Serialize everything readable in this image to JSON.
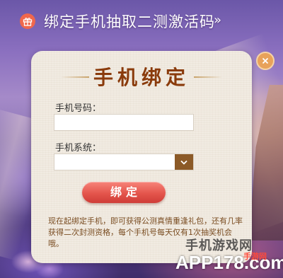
{
  "banner": {
    "title": "绑定手机抽取二测激活码",
    "chevron": "»",
    "icon": "gift-icon"
  },
  "dialog": {
    "title": "手机绑定",
    "phone_label": "手机号码：",
    "phone_value": "",
    "system_label": "手机系统：",
    "system_value": "",
    "bind_button": "绑定",
    "notice": "现在起绑定手机，即可获得公测真情重逢礼包，还有几率获得二次封测资格，每个手机号每天仅有1次抽奖机会哦。",
    "close_icon": "close-icon"
  },
  "watermark": {
    "top_text": "手机游戏网",
    "brand": "APP178.com",
    "sub": "手游网"
  },
  "colors": {
    "title_brown": "#8a3b0c",
    "button_red": "#e4554c",
    "notice_brown": "#7a4d22",
    "select_arrow_bg": "#8c5a27",
    "close_bg": "#e8a25a",
    "gift_bg": "#f0674c"
  }
}
